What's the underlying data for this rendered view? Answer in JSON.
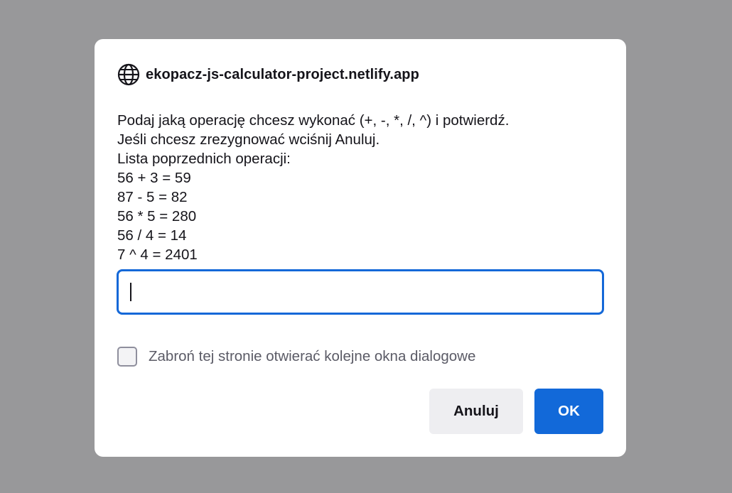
{
  "dialog": {
    "origin": "ekopacz-js-calculator-project.netlify.app",
    "origin_icon": "globe-icon",
    "message_lines": [
      "Podaj jaką operację chcesz wykonać (+, -, *, /, ^) i potwierdź.",
      "Jeśli chcesz zrezygnować wciśnij Anuluj.",
      "Lista poprzednich operacji:",
      "56 + 3 = 59",
      "87 - 5 = 82",
      "56 * 5 = 280",
      "56 / 4 = 14",
      "7 ^ 4 = 2401"
    ],
    "input_value": "",
    "checkbox_label": "Zabroń tej stronie otwierać kolejne okna dialogowe",
    "checkbox_checked": false,
    "cancel_label": "Anuluj",
    "ok_label": "OK"
  },
  "colors": {
    "overlay": "#98989a",
    "accent": "#1269d9",
    "focus_ring": "#1468d8",
    "secondary_button": "#eeeef1"
  }
}
